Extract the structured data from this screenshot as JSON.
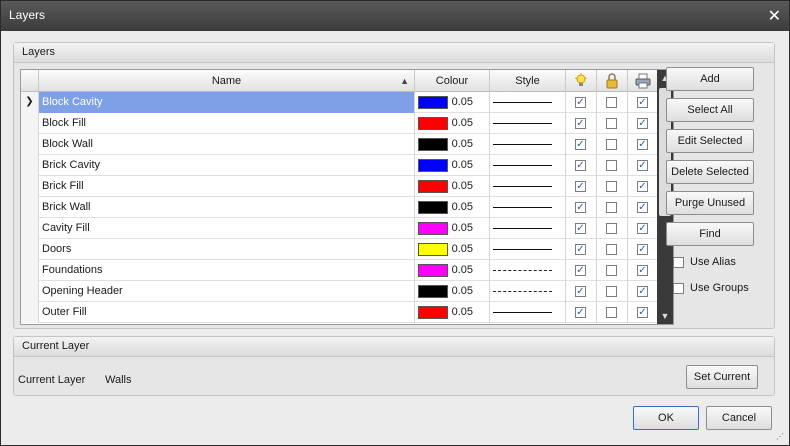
{
  "window": {
    "title": "Layers",
    "close_glyph": "✕"
  },
  "layers_group": {
    "header": "Layers"
  },
  "grid": {
    "columns": {
      "name": "Name",
      "colour": "Colour",
      "style": "Style",
      "on_icon": "lightbulb-icon",
      "lock_icon": "lock-icon",
      "print_icon": "printer-icon"
    },
    "rows": [
      {
        "name": "Block Cavity",
        "color": "#0000ff",
        "weight": "0.05",
        "style": "solid",
        "on": true,
        "locked": false,
        "print": true,
        "selected": true
      },
      {
        "name": "Block Fill",
        "color": "#ff0000",
        "weight": "0.05",
        "style": "solid",
        "on": true,
        "locked": false,
        "print": true
      },
      {
        "name": "Block Wall",
        "color": "#000000",
        "weight": "0.05",
        "style": "solid",
        "on": true,
        "locked": false,
        "print": true
      },
      {
        "name": "Brick Cavity",
        "color": "#0000ff",
        "weight": "0.05",
        "style": "solid",
        "on": true,
        "locked": false,
        "print": true
      },
      {
        "name": "Brick Fill",
        "color": "#ff0000",
        "weight": "0.05",
        "style": "solid",
        "on": true,
        "locked": false,
        "print": true
      },
      {
        "name": "Brick Wall",
        "color": "#000000",
        "weight": "0.05",
        "style": "solid",
        "on": true,
        "locked": false,
        "print": true
      },
      {
        "name": "Cavity Fill",
        "color": "#ff00ff",
        "weight": "0.05",
        "style": "solid",
        "on": true,
        "locked": false,
        "print": true
      },
      {
        "name": "Doors",
        "color": "#ffff00",
        "weight": "0.05",
        "style": "solid",
        "on": true,
        "locked": false,
        "print": true
      },
      {
        "name": "Foundations",
        "color": "#ff00ff",
        "weight": "0.05",
        "style": "dashed",
        "on": true,
        "locked": false,
        "print": true
      },
      {
        "name": "Opening Header",
        "color": "#000000",
        "weight": "0.05",
        "style": "dashed",
        "on": true,
        "locked": false,
        "print": true
      },
      {
        "name": "Outer Fill",
        "color": "#ff0000",
        "weight": "0.05",
        "style": "solid",
        "on": true,
        "locked": false,
        "print": true
      }
    ]
  },
  "side_buttons": {
    "add": "Add",
    "select_all": "Select All",
    "edit_selected": "Edit Selected",
    "delete_selected": "Delete Selected",
    "purge_unused": "Purge Unused",
    "find": "Find"
  },
  "options": {
    "use_alias": "Use Alias",
    "use_groups": "Use Groups"
  },
  "current_group": {
    "header": "Current Layer",
    "label": "Current Layer",
    "value": "Walls",
    "set_button": "Set Current"
  },
  "footer": {
    "ok": "OK",
    "cancel": "Cancel"
  }
}
